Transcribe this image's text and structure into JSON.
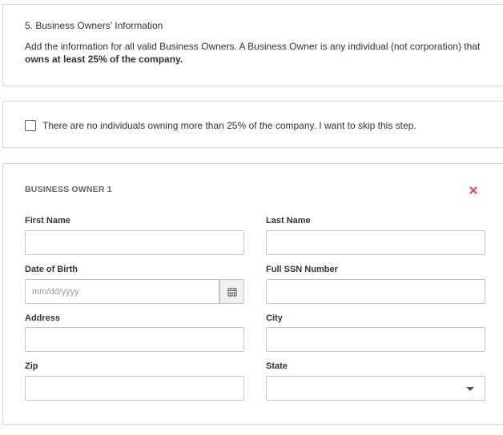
{
  "info_section": {
    "title": "5. Business Owners’ Information",
    "description_plain": "Add the information for all valid Business Owners. A Business Owner is any individual (not corporation) that",
    "description_bold": "owns at least 25% of the company."
  },
  "skip_option": {
    "label": "There are no individuals owning more than 25% of the company. I want to skip this step.",
    "checked": false
  },
  "owner": {
    "title": "BUSINESS OWNER 1",
    "remove_icon": "close-x-icon",
    "remove_color": "#e8465a",
    "fields": {
      "first_name": {
        "label": "First Name",
        "value": ""
      },
      "last_name": {
        "label": "Last Name",
        "value": ""
      },
      "dob": {
        "label": "Date of Birth",
        "placeholder": "mm/dd/yyyy",
        "value": "",
        "icon": "calendar-icon"
      },
      "ssn": {
        "label": "Full SSN Number",
        "value": ""
      },
      "address": {
        "label": "Address",
        "value": ""
      },
      "city": {
        "label": "City",
        "value": ""
      },
      "zip": {
        "label": "Zip",
        "value": ""
      },
      "state": {
        "label": "State",
        "value": "",
        "icon": "caret-down-icon"
      }
    }
  }
}
